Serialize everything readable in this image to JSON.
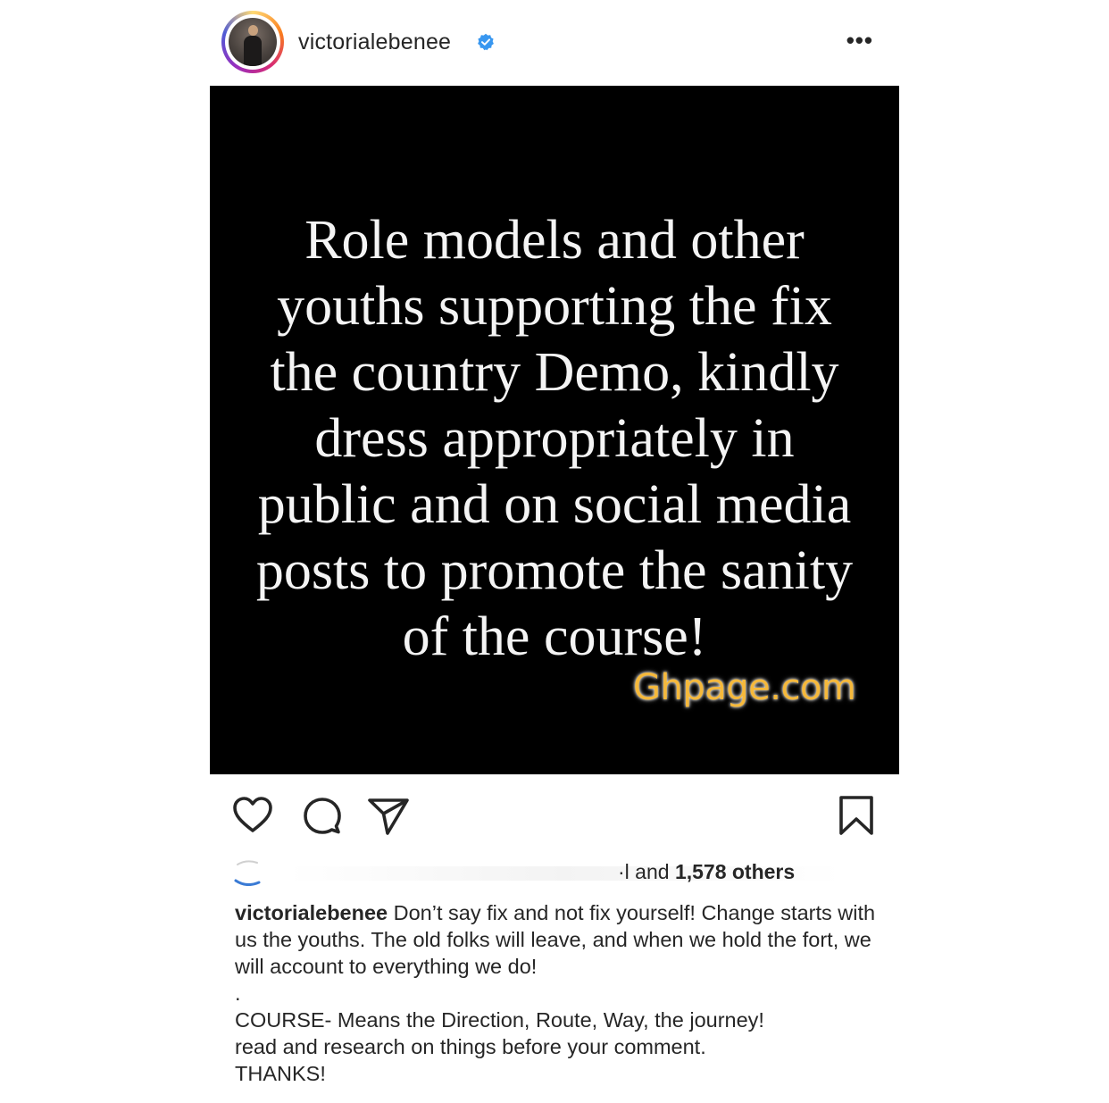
{
  "header": {
    "username": "victorialebenee",
    "verified": true,
    "more_label": "•••"
  },
  "post": {
    "lines": [
      "Role models and other",
      "youths supporting the fix",
      "the country Demo, kindly",
      "dress appropriately in",
      "public and on social media",
      "posts to promote the sanity",
      "of the course!"
    ],
    "watermark": "Ghpage.com",
    "background": "#000000",
    "text_color": "#f4f4f4",
    "watermark_color": "#f6b93b"
  },
  "actions": {
    "like_icon": "heart-icon",
    "comment_icon": "comment-icon",
    "share_icon": "paper-plane-icon",
    "save_icon": "bookmark-icon"
  },
  "likes": {
    "prefix": "·l and ",
    "count_text": "1,578 others"
  },
  "caption": {
    "username": "victorialebenee",
    "text": " Don’t say fix and not fix yourself! Change starts with us the youths. The old folks will leave, and when we hold the fort, we will account to everything we do!",
    "separator": ".",
    "line2": "COURSE- Means the Direction, Route, Way, the journey!",
    "line3": "read and research on things before your comment.",
    "line4": "THANKS!"
  }
}
